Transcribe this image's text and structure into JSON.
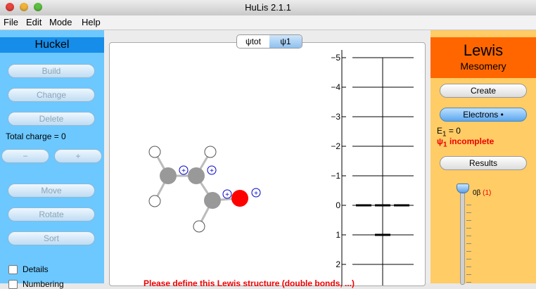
{
  "window": {
    "title": "HuLis 2.1.1"
  },
  "menu": [
    "File",
    "Edit",
    "Mode",
    "Help"
  ],
  "huckel": {
    "header": "Huckel",
    "build": "Build",
    "change": "Change",
    "delete": "Delete",
    "total_charge": "Total charge = 0",
    "minus": "−",
    "plus": "+",
    "move": "Move",
    "rotate": "Rotate",
    "sort": "Sort",
    "details": "Details",
    "numbering": "Numbering"
  },
  "tabs": [
    "ψtot",
    "ψ1"
  ],
  "tab_selected": 1,
  "energy_axis": {
    "labels": [
      "−5",
      "−4",
      "−3",
      "−2",
      "−1",
      "0",
      "1",
      "2"
    ],
    "levels": [
      {
        "value": 0,
        "count": 3
      },
      {
        "value": 1,
        "count": 1
      }
    ]
  },
  "warning": "Please define this Lewis structure (double bonds, ...)",
  "lewis": {
    "header": "Lewis",
    "subheader": "Mesomery",
    "create": "Create",
    "electrons": "Electrons •",
    "e1_label": "E",
    "e1_sub": "1",
    "e1_value": " = 0",
    "psi_label": "ψ",
    "psi_sub": "1",
    "psi_status": " incomplete",
    "results": "Results",
    "slider_label": "0β",
    "slider_count": "(1)"
  },
  "colors": {
    "huckel_panel": "#6cc8ff",
    "huckel_header": "#168de8",
    "lewis_panel": "#ffcc66",
    "lewis_header": "#ff6600",
    "carbon": "#999999",
    "oxygen": "#ff0000",
    "hydrogen": "#ffffff",
    "charge": "#0000cc",
    "warning": "#ee0000"
  },
  "molecule": {
    "atoms": [
      {
        "el": "H"
      },
      {
        "el": "H"
      },
      {
        "el": "C"
      },
      {
        "el": "C"
      },
      {
        "el": "H"
      },
      {
        "el": "C"
      },
      {
        "el": "O"
      },
      {
        "el": "H"
      }
    ],
    "charges": [
      "+",
      "+",
      "+",
      "+"
    ]
  }
}
